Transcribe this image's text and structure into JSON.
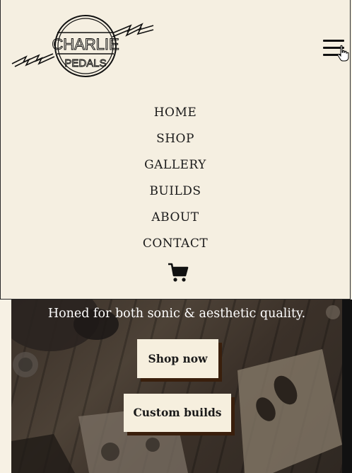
{
  "header": {
    "logo_line1": "CHARLIE",
    "logo_line2": "PEDALS"
  },
  "nav": {
    "items": [
      "HOME",
      "SHOP",
      "GALLERY",
      "BUILDS",
      "ABOUT",
      "CONTACT"
    ]
  },
  "hero": {
    "tagline": "Honed for both sonic & aesthetic quality.",
    "primary_button": "Shop now",
    "secondary_button": "Custom builds"
  },
  "icons": {
    "menu": "hamburger-icon",
    "cart": "cart-icon",
    "cursor": "hand-pointer-icon"
  },
  "colors": {
    "header_bg": "#f5efe1",
    "button_bg": "#f6efde",
    "button_shadow": "#3a1f0c",
    "text": "#1a1a1a"
  }
}
